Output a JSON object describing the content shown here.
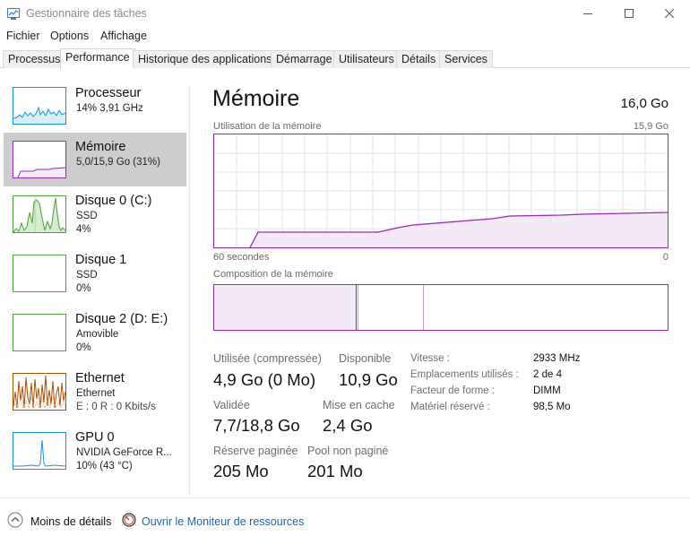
{
  "window": {
    "title": "Gestionnaire des tâches"
  },
  "menu": {
    "items": [
      "Fichier",
      "Options",
      "Affichage"
    ]
  },
  "tabs": [
    "Processus",
    "Performance",
    "Historique des applications",
    "Démarrage",
    "Utilisateurs",
    "Détails",
    "Services"
  ],
  "active_tab": "Performance",
  "sidebar": {
    "items": [
      {
        "title": "Processeur",
        "lines": [
          "14% 3,91 GHz"
        ],
        "color": "#1796d6",
        "utilization": 0.14
      },
      {
        "title": "Mémoire",
        "lines": [
          "5,0/15,9 Go (31%)"
        ],
        "color": "#9528b4",
        "utilization": 0.31
      },
      {
        "title": "Disque 0 (C:)",
        "lines": [
          "SSD",
          "4%"
        ],
        "color": "#4da03a",
        "utilization": 0.04
      },
      {
        "title": "Disque 1",
        "lines": [
          "SSD",
          "0%"
        ],
        "color": "#4da03a",
        "utilization": 0.0
      },
      {
        "title": "Disque 2 (D: E:)",
        "lines": [
          "Amovible",
          "0%"
        ],
        "color": "#4da03a",
        "utilization": 0.0
      },
      {
        "title": "Ethernet",
        "lines": [
          "Ethernet",
          "E : 0 R : 0 Kbits/s"
        ],
        "color": "#a74f01",
        "utilization": 0.0
      },
      {
        "title": "GPU 0",
        "lines": [
          "NVIDIA GeForce R...",
          "10% (43 °C)"
        ],
        "color": "#1796d6",
        "utilization": 0.1
      }
    ]
  },
  "main": {
    "title": "Mémoire",
    "total": "16,0 Go",
    "usage_chart": {
      "label": "Utilisation de la mémoire",
      "max_label": "15,9 Go",
      "x_left": "60 secondes",
      "x_right": "0",
      "color": "#9528b4"
    },
    "composition": {
      "label": "Composition de la mémoire",
      "in_use_fraction": 0.31,
      "modified_fraction": 0.003,
      "standby_fraction": 0.145,
      "free_fraction": 0.542
    },
    "stats": {
      "used_label": "Utilisée (compressée)",
      "used_value": "4,9 Go (0 Mo)",
      "available_label": "Disponible",
      "available_value": "10,9 Go",
      "committed_label": "Validée",
      "committed_value": "7,7/18,8 Go",
      "cached_label": "Mise en cache",
      "cached_value": "2,4 Go",
      "paged_label": "Réserve paginée",
      "paged_value": "205 Mo",
      "nonpaged_label": "Pool non paginé",
      "nonpaged_value": "201 Mo"
    },
    "specs": [
      {
        "label": "Vitesse :",
        "value": "2933 MHz"
      },
      {
        "label": "Emplacements utilisés :",
        "value": "2 de 4"
      },
      {
        "label": "Facteur de forme :",
        "value": "DIMM"
      },
      {
        "label": "Matériel réservé :",
        "value": "98,5 Mo"
      }
    ]
  },
  "footer": {
    "less_details": "Moins de détails",
    "resource_monitor": "Ouvrir le Moniteur de ressources"
  }
}
